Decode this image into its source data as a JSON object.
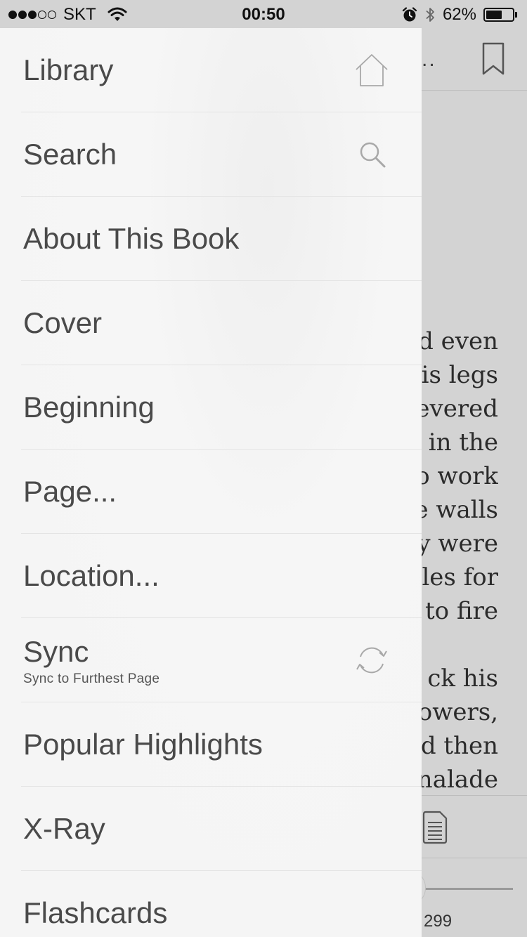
{
  "status_bar": {
    "signal_dots_filled": 3,
    "signal_dots_total": 5,
    "carrier": "SKT",
    "time": "00:50",
    "battery": "62%",
    "battery_level": 0.62
  },
  "reader": {
    "header_ellipsis": "..",
    "page_text_lines": [
      "d even",
      "is legs",
      "evered",
      " in the",
      "o work",
      "e walls",
      "y were",
      "les for",
      "to fire",
      "",
      "ck his",
      "owers,",
      "d then",
      "nalade"
    ],
    "page_number": "299"
  },
  "menu": {
    "items": [
      {
        "label": "Library",
        "icon": "home-icon"
      },
      {
        "label": "Search",
        "icon": "search-icon"
      },
      {
        "label": "About This Book"
      },
      {
        "label": "Cover"
      },
      {
        "label": "Beginning"
      },
      {
        "label": "Page..."
      },
      {
        "label": "Location..."
      },
      {
        "label": "Sync",
        "sublabel": "Sync to Furthest Page",
        "icon": "sync-icon"
      },
      {
        "label": "Popular Highlights"
      },
      {
        "label": "X-Ray"
      },
      {
        "label": "Flashcards"
      }
    ]
  }
}
